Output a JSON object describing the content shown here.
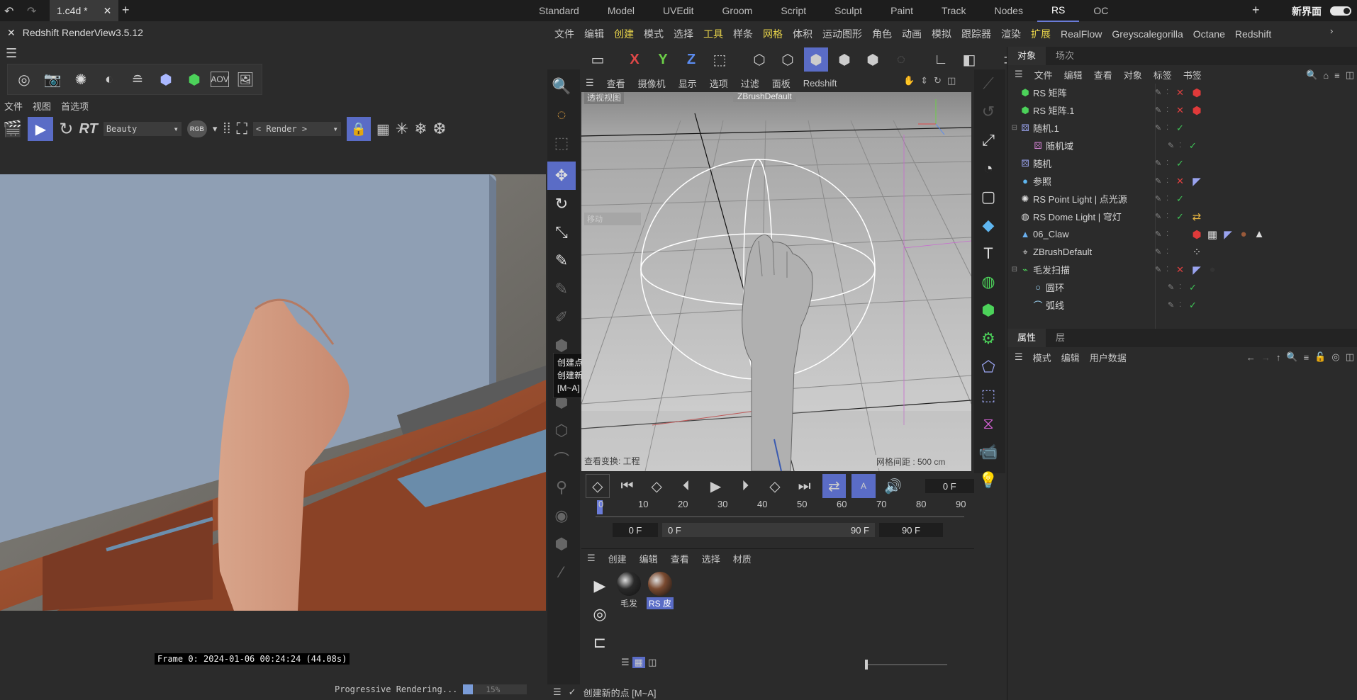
{
  "topbar": {
    "file_tab": "1.c4d *",
    "layouts": [
      "Standard",
      "Model",
      "UVEdit",
      "Groom",
      "Script",
      "Sculpt",
      "Paint",
      "Track",
      "Nodes",
      "RS",
      "OC"
    ],
    "active_layout": "RS",
    "new_interface": "新界面"
  },
  "renderview": {
    "title": "Redshift RenderView3.5.12",
    "menus": [
      "文件",
      "视图",
      "首选项"
    ],
    "rt_label": "RT",
    "aov_select": "Beauty",
    "rgb_label": "RGB",
    "render_select": "< Render >",
    "frame_info": "Frame  0:  2024-01-06  00:24:24  (44.08s)",
    "progress_text": "Progressive Rendering...",
    "progress_percent": "15%",
    "progress_value": 0.15
  },
  "main_menu": [
    "文件",
    "编辑",
    "创建",
    "模式",
    "选择",
    "工具",
    "样条",
    "网格",
    "体积",
    "运动图形",
    "角色",
    "动画",
    "模拟",
    "跟踪器",
    "渲染",
    "扩展",
    "RealFlow",
    "Greyscalegorilla",
    "Octane",
    "Redshift"
  ],
  "highlight_menus": [
    "创建",
    "工具",
    "网格",
    "扩展"
  ],
  "axis_buttons": [
    "X",
    "Y",
    "Z"
  ],
  "viewport": {
    "menu": [
      "查看",
      "摄像机",
      "显示",
      "选项",
      "过滤",
      "面板",
      "Redshift"
    ],
    "label": "透视视图",
    "camera": "ZBrushDefault",
    "move_label": "移动",
    "transform_label": "查看变换: 工程",
    "grid_label": "网格间距 : 500 cm"
  },
  "tooltip": {
    "title": "创建点",
    "desc": "创建新的点",
    "shortcut": "[M~A]"
  },
  "timeline": {
    "current_frame": "0 F",
    "ticks": [
      "0",
      "10",
      "20",
      "30",
      "40",
      "50",
      "60",
      "70",
      "80",
      "90"
    ],
    "start": "0 F",
    "range_start": "0 F",
    "range_end": "90 F",
    "end": "90 F"
  },
  "material_manager": {
    "menu": [
      "创建",
      "编辑",
      "查看",
      "选择",
      "材质"
    ],
    "materials": [
      {
        "name": "毛发",
        "color": "#2a2a2a"
      },
      {
        "name": "RS 皮",
        "color": "#7a4a30"
      }
    ]
  },
  "status": "创建新的点 [M~A]",
  "object_manager": {
    "tabs": [
      "对象",
      "场次"
    ],
    "menu": [
      "文件",
      "编辑",
      "查看",
      "对象",
      "标签",
      "书签"
    ],
    "objects": [
      {
        "name": "RS 矩阵",
        "indent": 0,
        "icon": "cube-green-icon",
        "state": "x",
        "tags": [
          "red-cube"
        ]
      },
      {
        "name": "RS 矩阵.1",
        "indent": 0,
        "icon": "cube-green-icon",
        "state": "x",
        "tags": [
          "red-cube"
        ]
      },
      {
        "name": "随机.1",
        "indent": 0,
        "icon": "dice-icon",
        "state": "check",
        "tags": []
      },
      {
        "name": "随机域",
        "indent": 1,
        "icon": "dice-pink-icon",
        "state": "check",
        "tags": []
      },
      {
        "name": "随机",
        "indent": 0,
        "icon": "dice-icon",
        "state": "check",
        "tags": []
      },
      {
        "name": "参照",
        "indent": 0,
        "icon": "sphere-icon",
        "state": "x",
        "tags": [
          "tag"
        ]
      },
      {
        "name": "RS Point Light | 点光源",
        "indent": 0,
        "icon": "bulb-icon",
        "state": "check",
        "tags": []
      },
      {
        "name": "RS Dome Light | 穹灯",
        "indent": 0,
        "icon": "dome-icon",
        "state": "check",
        "tags": [
          "yellow"
        ]
      },
      {
        "name": "06_Claw",
        "indent": 0,
        "icon": "polygon-icon",
        "state": "",
        "tags": [
          "red-cube",
          "checker",
          "tag",
          "ball",
          "tri"
        ]
      },
      {
        "name": "ZBrushDefault",
        "indent": 0,
        "icon": "camera-icon",
        "state": "",
        "tags": [
          "dots"
        ]
      },
      {
        "name": "毛发扫描",
        "indent": 0,
        "icon": "sweep-icon",
        "state": "x",
        "tags": [
          "tag",
          "ball-dark"
        ]
      },
      {
        "name": "圆环",
        "indent": 1,
        "icon": "circle-icon",
        "state": "check",
        "tags": []
      },
      {
        "name": "弧线",
        "indent": 1,
        "icon": "arc-icon",
        "state": "check",
        "tags": []
      }
    ]
  },
  "attributes": {
    "tabs": [
      "属性",
      "层"
    ],
    "menu": [
      "模式",
      "编辑",
      "用户数据"
    ]
  }
}
